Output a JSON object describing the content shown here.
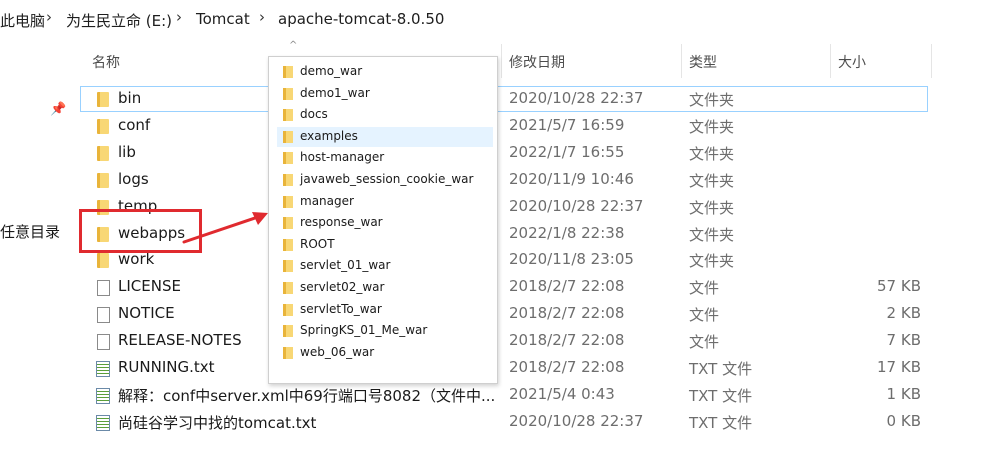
{
  "breadcrumb": [
    "此电脑",
    "为生民立命 (E:)",
    "Tomcat",
    "apache-tomcat-8.0.50"
  ],
  "columns": {
    "name": "名称",
    "modified": "修改日期",
    "type": "类型",
    "size": "大小"
  },
  "sidebar": {
    "quick_access_label": "任意目录"
  },
  "files": [
    {
      "name": "bin",
      "modified": "2020/10/28 22:37",
      "type": "文件夹",
      "size": "",
      "icon": "folder-icon",
      "selected": true
    },
    {
      "name": "conf",
      "modified": "2021/5/7 16:59",
      "type": "文件夹",
      "size": "",
      "icon": "folder-icon"
    },
    {
      "name": "lib",
      "modified": "2022/1/7 16:55",
      "type": "文件夹",
      "size": "",
      "icon": "folder-icon"
    },
    {
      "name": "logs",
      "modified": "2020/11/9 10:46",
      "type": "文件夹",
      "size": "",
      "icon": "folder-icon"
    },
    {
      "name": "temp",
      "modified": "2020/10/28 22:37",
      "type": "文件夹",
      "size": "",
      "icon": "folder-icon"
    },
    {
      "name": "webapps",
      "modified": "2022/1/8 22:38",
      "type": "文件夹",
      "size": "",
      "icon": "folder-icon",
      "annotated": true
    },
    {
      "name": "work",
      "modified": "2020/11/8 23:05",
      "type": "文件夹",
      "size": "",
      "icon": "folder-icon"
    },
    {
      "name": "LICENSE",
      "modified": "2018/2/7 22:08",
      "type": "文件",
      "size": "57 KB",
      "icon": "file-icon"
    },
    {
      "name": "NOTICE",
      "modified": "2018/2/7 22:08",
      "type": "文件",
      "size": "2 KB",
      "icon": "file-icon"
    },
    {
      "name": "RELEASE-NOTES",
      "modified": "2018/2/7 22:08",
      "type": "文件",
      "size": "7 KB",
      "icon": "file-icon"
    },
    {
      "name": "RUNNING.txt",
      "modified": "2018/2/7 22:08",
      "type": "TXT 文件",
      "size": "17 KB",
      "icon": "txt-icon"
    },
    {
      "name": "解释：conf中server.xml中69行端口号8082（文件中...",
      "modified": "2021/5/4 0:43",
      "type": "TXT 文件",
      "size": "1 KB",
      "icon": "txt-icon"
    },
    {
      "name": "尚硅谷学习中找的tomcat.txt",
      "modified": "2020/10/28 22:37",
      "type": "TXT 文件",
      "size": "0 KB",
      "icon": "txt-icon"
    }
  ],
  "webapps_popup": {
    "items": [
      "demo_war",
      "demo1_war",
      "docs",
      "examples",
      "host-manager",
      "javaweb_session_cookie_war",
      "manager",
      "response_war",
      "ROOT",
      "servlet_01_war",
      "servlet02_war",
      "servletTo_war",
      "SpringKS_01_Me_war",
      "web_06_war"
    ],
    "highlighted_index": 3
  },
  "annotation": {
    "color": "#e02a2f"
  }
}
